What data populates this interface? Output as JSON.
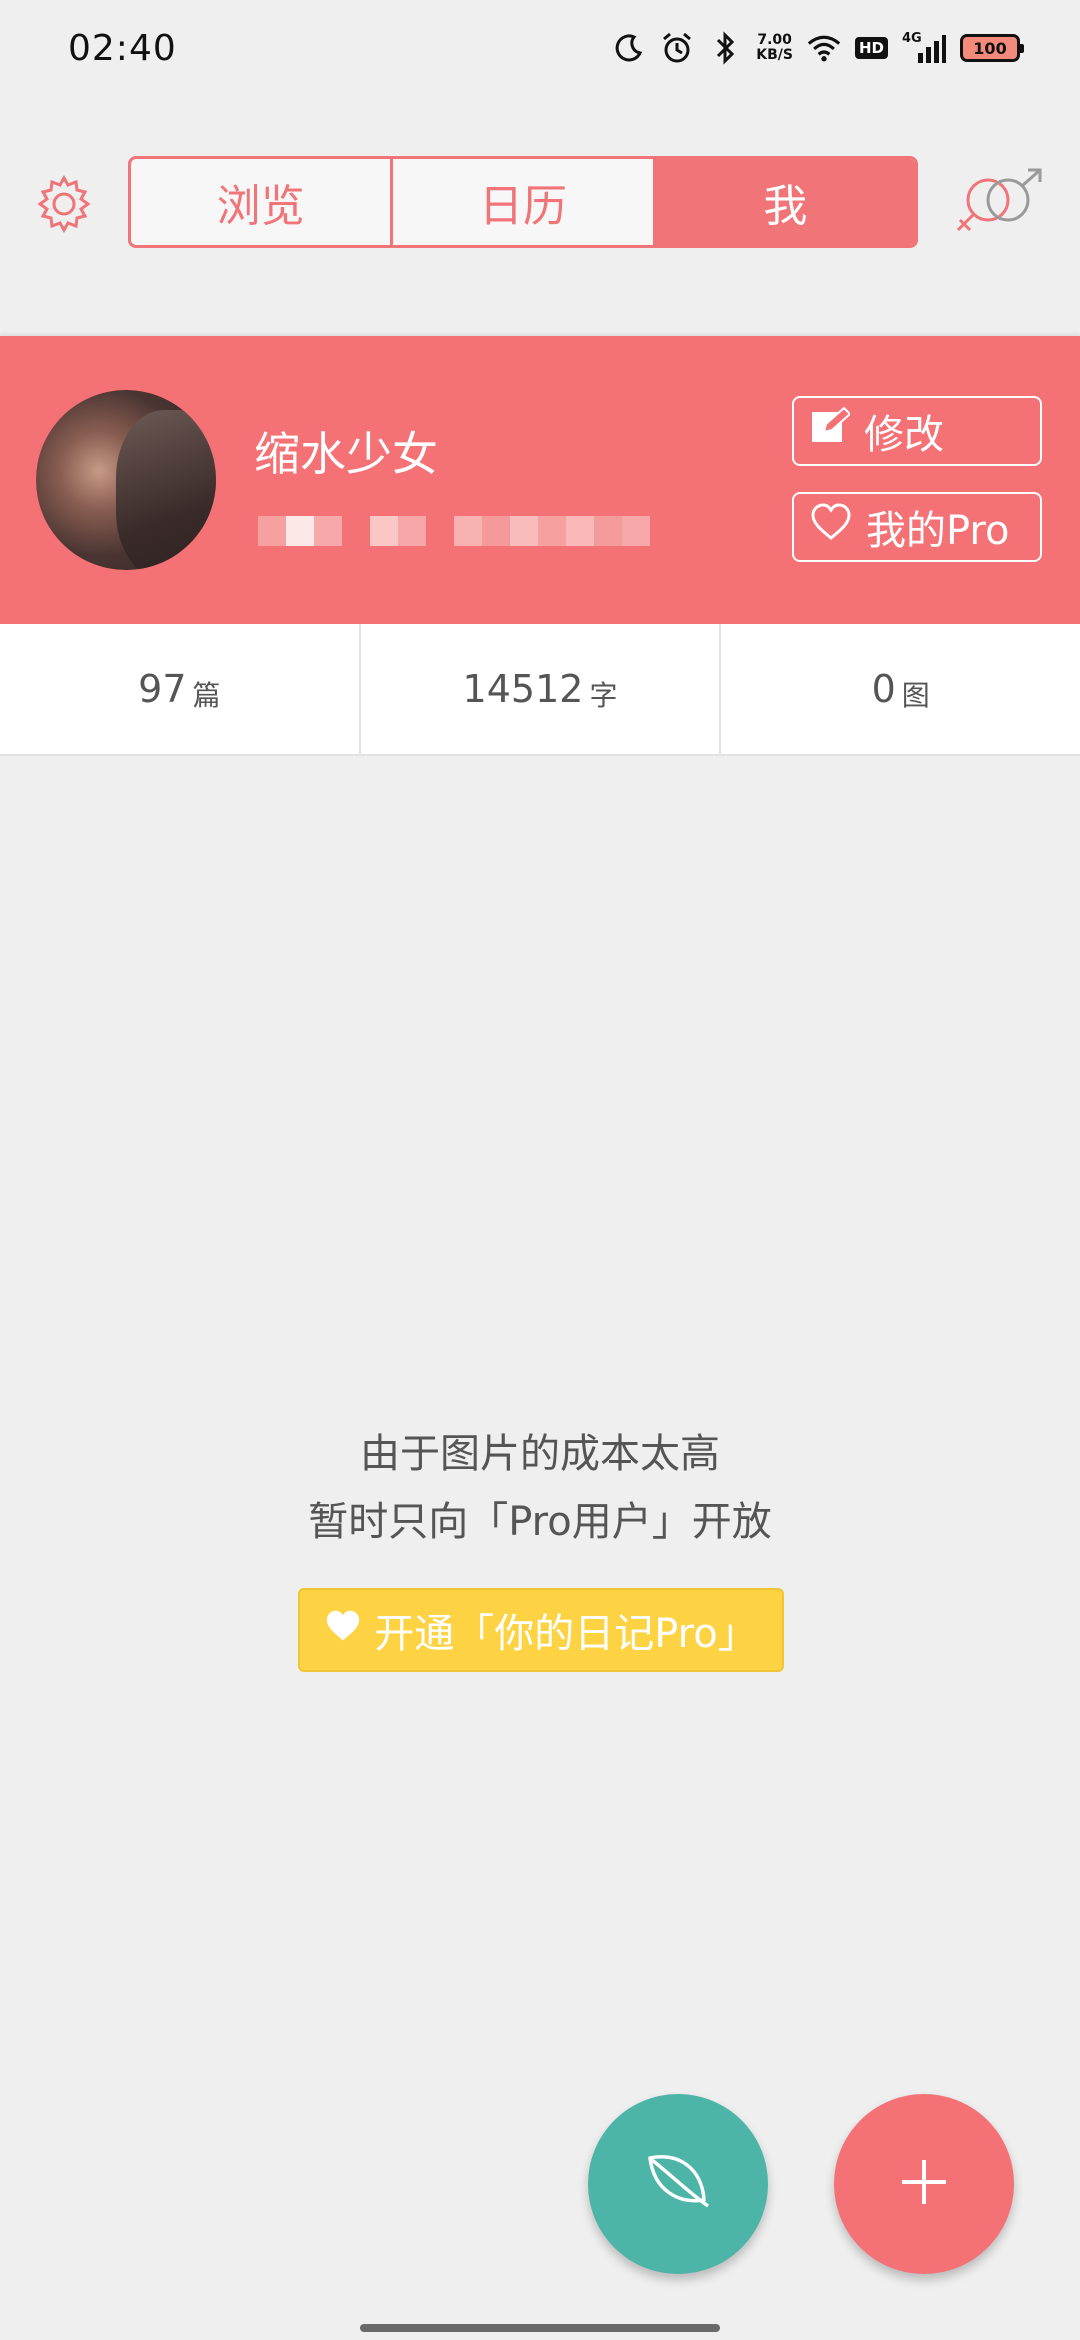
{
  "status_bar": {
    "time": "02:40",
    "net_speed_value": "7.00",
    "net_speed_unit": "KB/S",
    "hd_label": "HD",
    "signal_label": "4G",
    "battery_level": "100",
    "icons": [
      "moon-icon",
      "alarm-icon",
      "bluetooth-icon",
      "wifi-icon",
      "cell-signal-icon",
      "battery-icon"
    ]
  },
  "header": {
    "tabs": [
      {
        "label": "浏览",
        "active": false
      },
      {
        "label": "日历",
        "active": false
      },
      {
        "label": "我",
        "active": true
      }
    ],
    "left_icon": "gear-icon",
    "right_icon": "gender-icon"
  },
  "profile": {
    "username": "缩水少女",
    "edit_button": "修改",
    "pro_button": "我的Pro"
  },
  "stats": [
    {
      "value": "97",
      "unit": "篇"
    },
    {
      "value": "14512",
      "unit": "字"
    },
    {
      "value": "0",
      "unit": "图"
    }
  ],
  "notice": {
    "line1": "由于图片的成本太高",
    "line2": "暂时只向「Pro用户」开放",
    "cta": "开通「你的日记Pro」"
  },
  "fabs": {
    "leaf": "leaf-icon",
    "add": "plus-icon"
  },
  "colors": {
    "accent": "#f47175",
    "teal": "#4db4a8",
    "yellow": "#fdd344",
    "background": "#efefef"
  }
}
